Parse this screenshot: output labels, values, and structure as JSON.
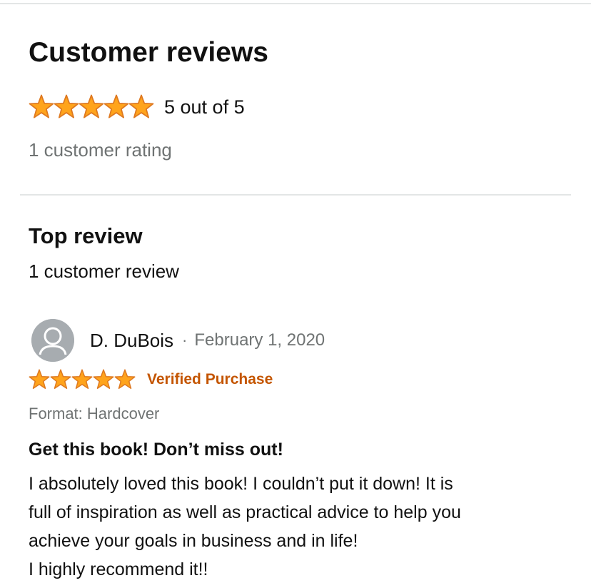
{
  "summary": {
    "heading": "Customer reviews",
    "stars": 5,
    "rating_text": "5 out of 5",
    "rating_count": "1 customer rating"
  },
  "top_review": {
    "heading": "Top review",
    "review_count": "1 customer review"
  },
  "review": {
    "reviewer_name": "D. DuBois",
    "separator": "·",
    "date": "February 1, 2020",
    "stars": 5,
    "verified_label": "Verified Purchase",
    "format": "Format: Hardcover",
    "title": "Get this book! Don’t miss out!",
    "body_lines": [
      "I absolutely loved this book! I couldn’t put it down! It is",
      "full of inspiration as well as practical advice to help you",
      "achieve your goals in business and in life!",
      "I highly recommend it!!"
    ]
  },
  "icons": {
    "star": "star-icon",
    "avatar": "user-avatar-icon"
  },
  "colors": {
    "star_fill": "#ffa41c",
    "star_stroke": "#de7921",
    "verified": "#c45500",
    "secondary_text": "#6f7373",
    "divider": "#e3e6e6"
  }
}
